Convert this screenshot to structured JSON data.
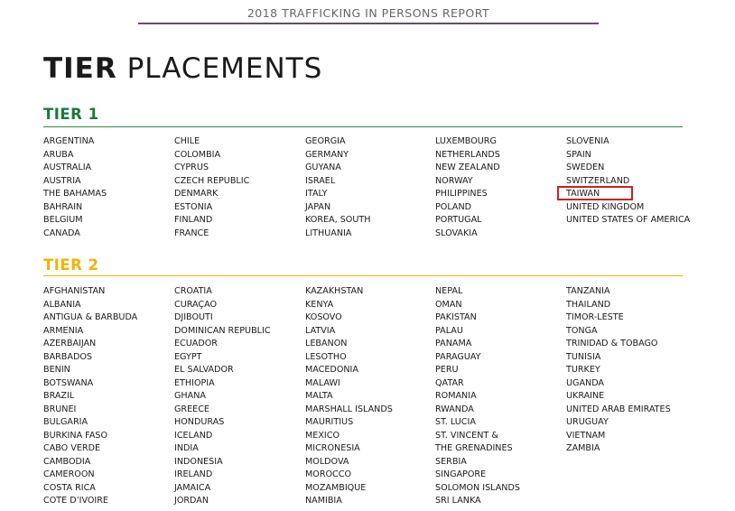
{
  "header": {
    "report_title": "2018 TRAFFICKING IN PERSONS REPORT"
  },
  "page_title": {
    "bold": "TIER",
    "rest": " PLACEMENTS"
  },
  "tier1": {
    "heading": "TIER 1",
    "color": "#1a7a3c",
    "columns": [
      [
        "ARGENTINA",
        "ARUBA",
        "AUSTRALIA",
        "AUSTRIA",
        "THE BAHAMAS",
        "BAHRAIN",
        "BELGIUM",
        "CANADA"
      ],
      [
        "CHILE",
        "COLOMBIA",
        "CYPRUS",
        "CZECH REPUBLIC",
        "DENMARK",
        "ESTONIA",
        "FINLAND",
        "FRANCE"
      ],
      [
        "GEORGIA",
        "GERMANY",
        "GUYANA",
        "ISRAEL",
        "ITALY",
        "JAPAN",
        "KOREA, SOUTH",
        "LITHUANIA"
      ],
      [
        "LUXEMBOURG",
        "NETHERLANDS",
        "NEW ZEALAND",
        "NORWAY",
        "PHILIPPINES",
        "POLAND",
        "PORTUGAL",
        "SLOVAKIA"
      ],
      [
        "SLOVENIA",
        "SPAIN",
        "SWEDEN",
        "SWITZERLAND",
        "TAIWAN",
        "UNITED KINGDOM",
        "UNITED STATES OF AMERICA"
      ]
    ]
  },
  "tier2": {
    "heading": "TIER 2",
    "color": "#f0b400",
    "columns": [
      [
        "AFGHANISTAN",
        "ALBANIA",
        "ANTIGUA & BARBUDA",
        "ARMENIA",
        "AZERBAIJAN",
        "BARBADOS",
        "BENIN",
        "BOTSWANA",
        "BRAZIL",
        "BRUNEI",
        "BULGARIA",
        "BURKINA FASO",
        "CABO VERDE",
        "CAMBODIA",
        "CAMEROON",
        "COSTA RICA",
        "COTE D’IVOIRE"
      ],
      [
        "CROATIA",
        "CURAÇAO",
        "DJIBOUTI",
        "DOMINICAN REPUBLIC",
        "ECUADOR",
        "EGYPT",
        "EL SALVADOR",
        "ETHIOPIA",
        "GHANA",
        "GREECE",
        "HONDURAS",
        "ICELAND",
        "INDIA",
        "INDONESIA",
        "IRELAND",
        "JAMAICA",
        "JORDAN"
      ],
      [
        "KAZAKHSTAN",
        "KENYA",
        "KOSOVO",
        "LATVIA",
        "LEBANON",
        "LESOTHO",
        "MACEDONIA",
        "MALAWI",
        "MALTA",
        "MARSHALL ISLANDS",
        "MAURITIUS",
        "MEXICO",
        "MICRONESIA",
        "MOLDOVA",
        "MOROCCO",
        "MOZAMBIQUE",
        "NAMIBIA"
      ],
      [
        "NEPAL",
        "OMAN",
        "PAKISTAN",
        "PALAU",
        "PANAMA",
        "PARAGUAY",
        "PERU",
        "QATAR",
        "ROMANIA",
        "RWANDA",
        "ST. LUCIA",
        "ST. VINCENT & THE GRENADINES",
        "SERBIA",
        "SINGAPORE",
        "SOLOMON ISLANDS",
        "SRI LANKA"
      ],
      [
        "TANZANIA",
        "THAILAND",
        "TIMOR-LESTE",
        "TONGA",
        "TRINIDAD & TOBAGO",
        "TUNISIA",
        "TURKEY",
        "UGANDA",
        "UKRAINE",
        "UNITED ARAB EMIRATES",
        "URUGUAY",
        "VIETNAM",
        "ZAMBIA"
      ]
    ]
  },
  "highlight": {
    "country": "TAIWAN",
    "color": "#d02020"
  }
}
